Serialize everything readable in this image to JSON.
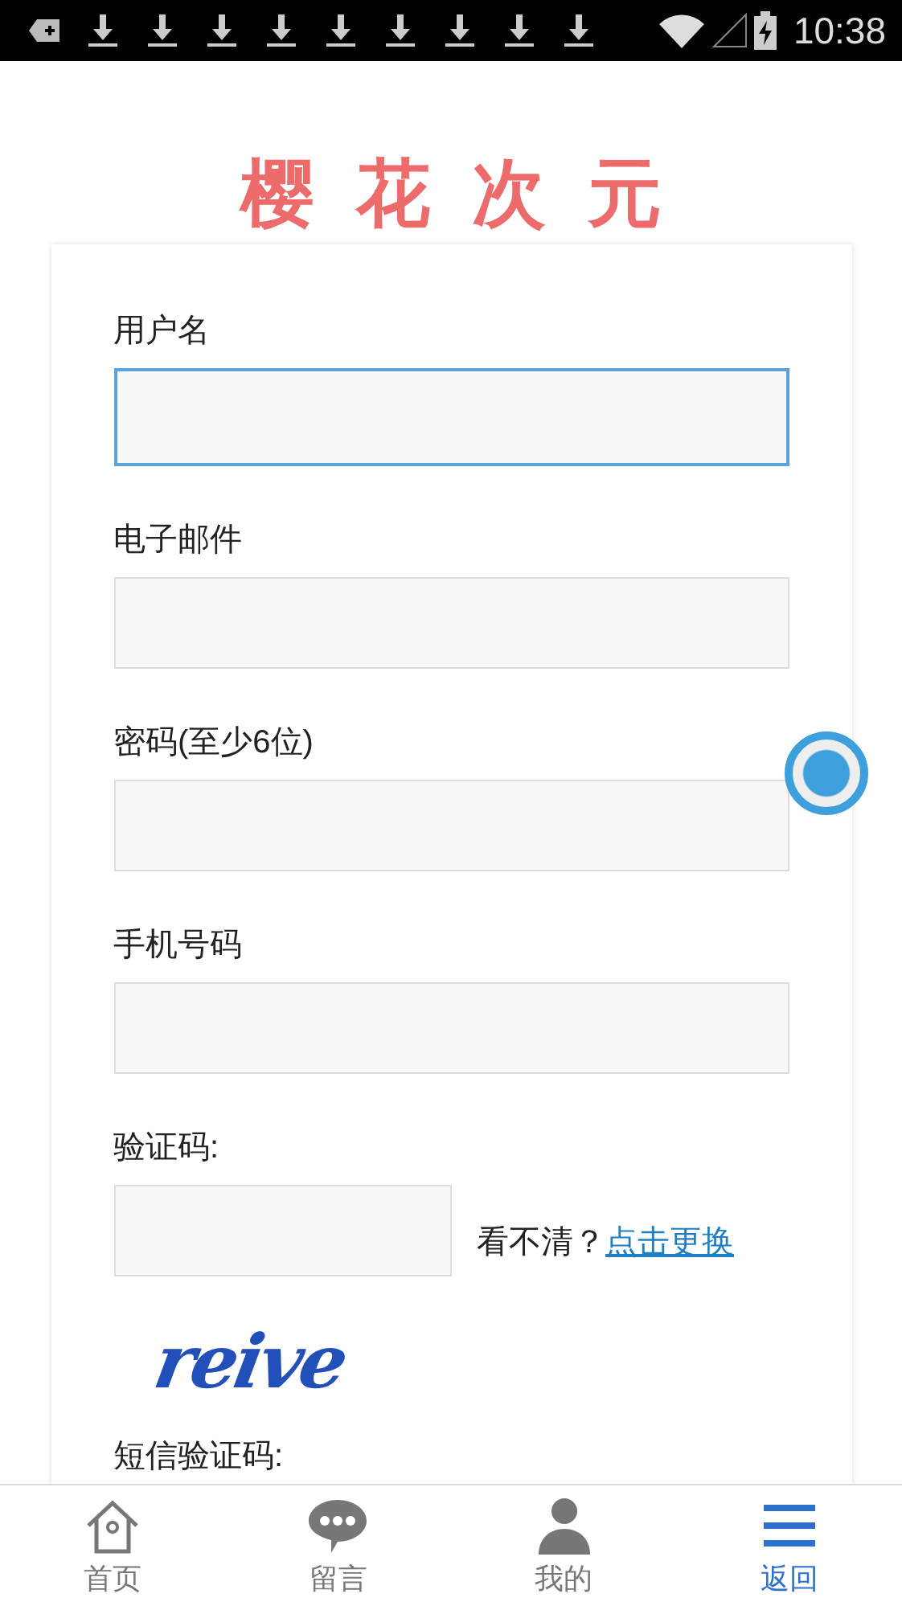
{
  "status_bar": {
    "time": "10:38"
  },
  "logo": {
    "text": "樱花次元"
  },
  "form": {
    "fields": [
      {
        "label": "用户名",
        "focused": true
      },
      {
        "label": "电子邮件",
        "focused": false
      },
      {
        "label": "密码(至少6位)",
        "focused": false
      },
      {
        "label": "手机号码",
        "focused": false
      }
    ],
    "captcha": {
      "label": "验证码:",
      "hint": "看不清？",
      "link": "点击更换",
      "image_text": "reive"
    },
    "sms_label": "短信验证码:"
  },
  "nav": [
    {
      "label": "首页",
      "kind": "home",
      "selected": false
    },
    {
      "label": "留言",
      "kind": "chat",
      "selected": false
    },
    {
      "label": "我的",
      "kind": "user",
      "selected": false
    },
    {
      "label": "返回",
      "kind": "menu",
      "selected": true
    }
  ]
}
